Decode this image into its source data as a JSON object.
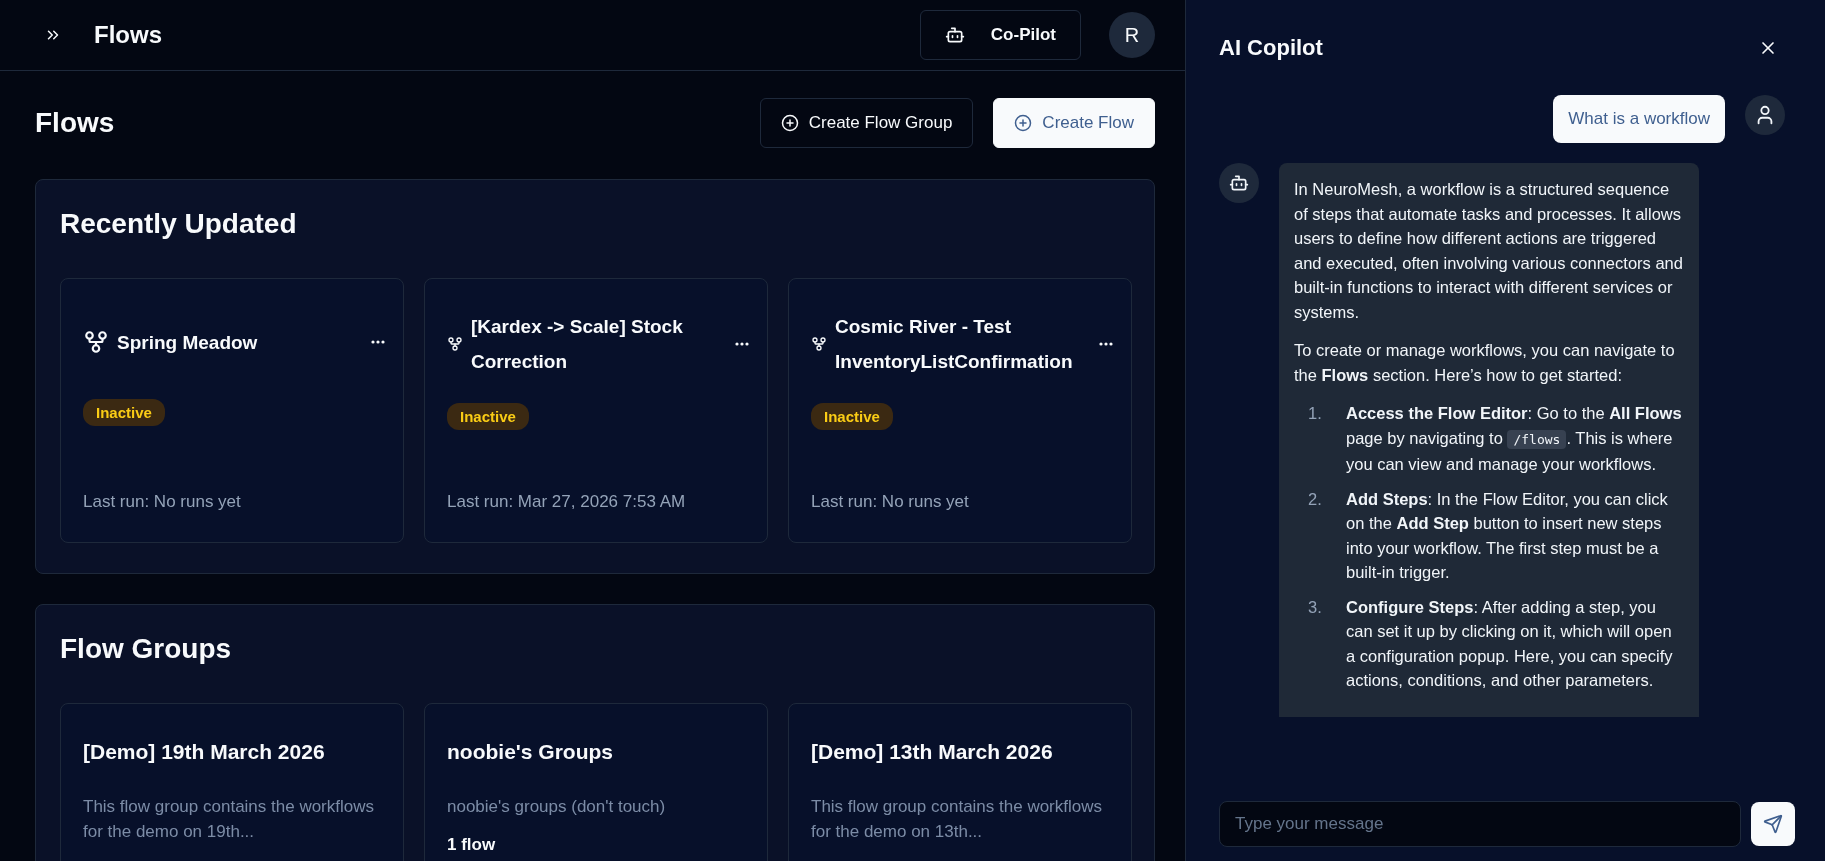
{
  "header": {
    "title": "Flows",
    "copilot_button": "Co-Pilot",
    "avatar": "R"
  },
  "page": {
    "title": "Flows",
    "buttons": [
      {
        "label": "Create Flow Group",
        "kind": "outline"
      },
      {
        "label": "Create Flow",
        "kind": "solid"
      }
    ]
  },
  "recently_updated": {
    "title": "Recently Updated",
    "flows": [
      {
        "name": "Spring Meadow",
        "status": "Inactive",
        "last_run": "Last run: No runs yet"
      },
      {
        "name": "[Kardex -> Scale] Stock Correction",
        "status": "Inactive",
        "last_run": "Last run: Mar 27, 2026 7:53 AM"
      },
      {
        "name": "Cosmic River - Test InventoryListConfirmation",
        "status": "Inactive",
        "last_run": "Last run: No runs yet"
      }
    ]
  },
  "flow_groups": {
    "title": "Flow Groups",
    "groups": [
      {
        "name": "[Demo] 19th March 2026",
        "description": "This flow group contains the workflows for the demo on 19th..."
      },
      {
        "name": "noobie's Groups",
        "description": "noobie's groups (don't touch)",
        "count": "1 flow"
      },
      {
        "name": "[Demo] 13th March 2026",
        "description": "This flow group contains the workflows for the demo on 13th..."
      }
    ]
  },
  "copilot": {
    "title": "AI Copilot",
    "user_message": "What is a workflow",
    "reply": {
      "paragraphs": [
        "In NeuroMesh, a workflow is a structured sequence of steps that automate tasks and processes. It allows users to define how different actions are triggered and executed, often involving various connectors and built-in functions to interact with different services or systems.",
        "To create or manage workflows, you can navigate to the **Flows** section. Here’s how to get started:"
      ],
      "steps": [
        {
          "number": "1.",
          "text": "**Access the Flow Editor**: Go to the **All Flows** page by navigating to",
          "code": "/flows",
          "after": ". This is where you can view and manage your workflows."
        },
        {
          "number": "2.",
          "text": "**Add Steps**: In the Flow Editor, you can click on the **Add Step** button to insert new steps into your workflow. The first step must be a built-in trigger."
        },
        {
          "number": "3.",
          "text": "**Configure Steps**: After adding a step, you can set it up by clicking on it, which will open a configuration popup. Here, you can specify actions, conditions, and other parameters."
        }
      ]
    },
    "input": {
      "placeholder": "Type your message"
    }
  }
}
